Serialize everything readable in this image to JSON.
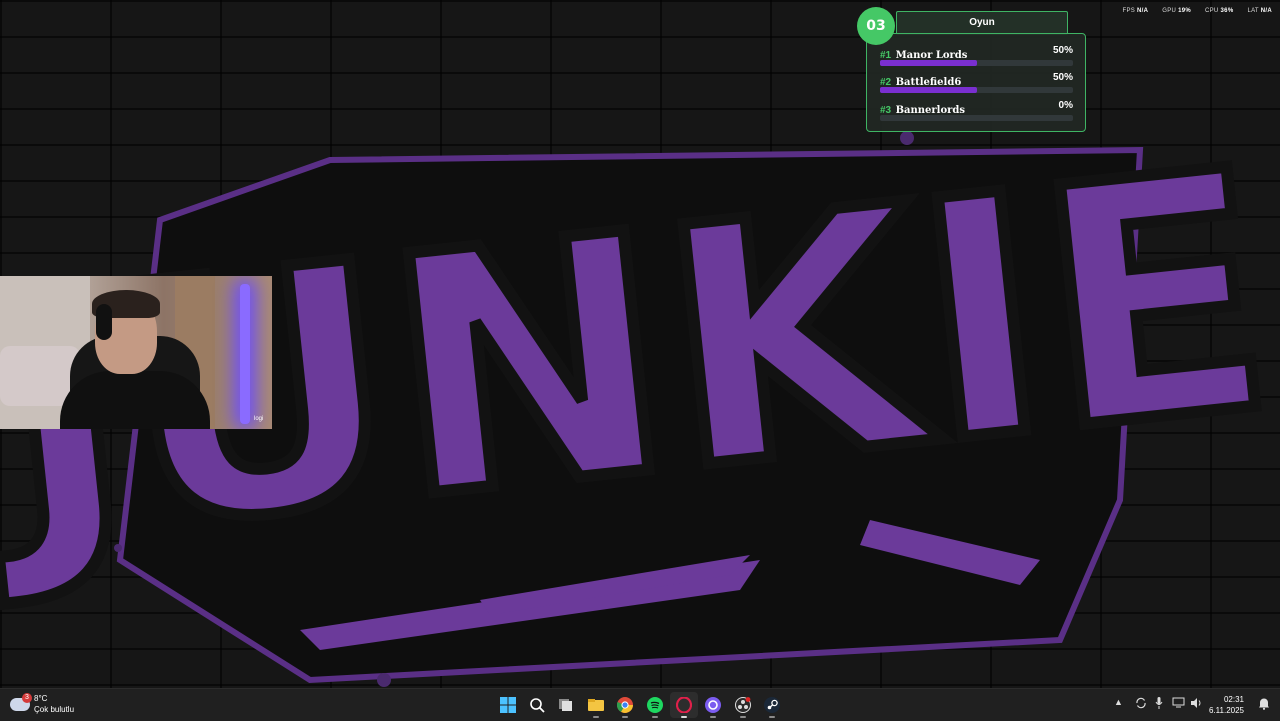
{
  "wallpaper": {
    "logo_text": "JUNKIE"
  },
  "webcam": {
    "brand": "logi"
  },
  "poll": {
    "badge": "03",
    "title": "Oyun",
    "items": [
      {
        "rank": "#1",
        "name": "Manor Lords",
        "percent": "50%",
        "value": 0.5
      },
      {
        "rank": "#2",
        "name": "Battlefield6",
        "percent": "50%",
        "value": 0.5
      },
      {
        "rank": "#3",
        "name": "Bannerlords",
        "percent": "0%",
        "value": 0
      }
    ],
    "accent": "#45c866",
    "bar_color": "#7a2fd0"
  },
  "perf": {
    "fps_label": "FPS",
    "fps": "N/A",
    "gpu_label": "GPU",
    "gpu": "19%",
    "cpu_label": "CPU",
    "cpu": "36%",
    "lat_label": "LAT",
    "lat": "N/A"
  },
  "taskbar": {
    "weather": {
      "temp": "8°C",
      "condition": "Çok bulutlu",
      "badge": "3"
    },
    "apps": [
      {
        "name": "windows-start-icon"
      },
      {
        "name": "search-icon"
      },
      {
        "name": "task-view-icon"
      },
      {
        "name": "file-explorer-icon"
      },
      {
        "name": "chrome-icon"
      },
      {
        "name": "spotify-icon"
      },
      {
        "name": "opera-gx-icon"
      },
      {
        "name": "discord-like-icon"
      },
      {
        "name": "obs-icon"
      },
      {
        "name": "steam-icon"
      }
    ],
    "clock": {
      "time": "02:31",
      "date": "6.11.2025"
    }
  }
}
